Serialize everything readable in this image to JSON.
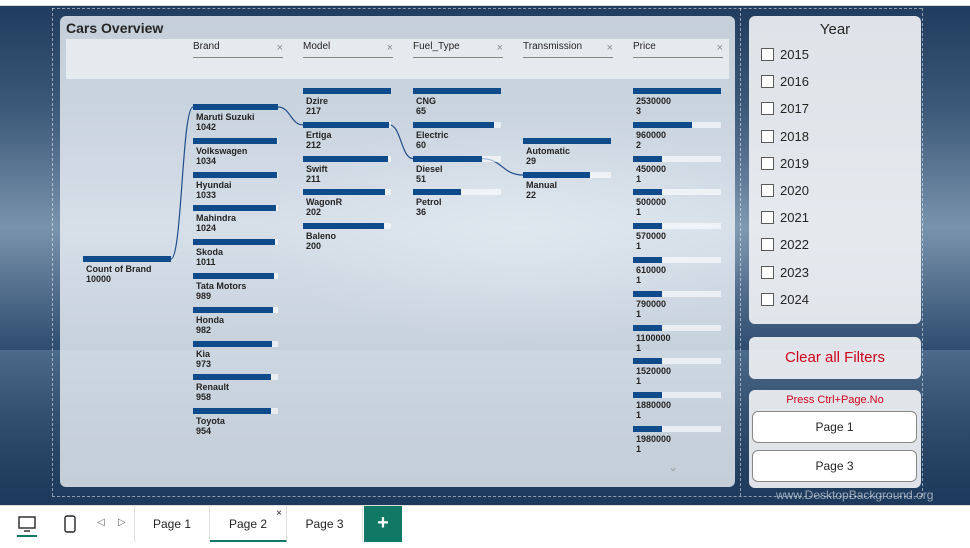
{
  "decomposition": {
    "title": "Cars Overview",
    "columns": [
      {
        "label": "Brand",
        "close": "×"
      },
      {
        "label": "Model",
        "close": "×"
      },
      {
        "label": "Fuel_Type",
        "close": "×"
      },
      {
        "label": "Transmission",
        "close": "×"
      },
      {
        "label": "Price",
        "close": "×"
      }
    ],
    "root": {
      "label": "Count of Brand",
      "value": "10000",
      "fraction": 1.0
    },
    "brand": [
      {
        "label": "Maruti Suzuki",
        "value": "1042",
        "fraction": 1.0
      },
      {
        "label": "Volkswagen",
        "value": "1034",
        "fraction": 0.99
      },
      {
        "label": "Hyundai",
        "value": "1033",
        "fraction": 0.99
      },
      {
        "label": "Mahindra",
        "value": "1024",
        "fraction": 0.98
      },
      {
        "label": "Skoda",
        "value": "1011",
        "fraction": 0.97
      },
      {
        "label": "Tata Motors",
        "value": "989",
        "fraction": 0.95
      },
      {
        "label": "Honda",
        "value": "982",
        "fraction": 0.94
      },
      {
        "label": "Kia",
        "value": "973",
        "fraction": 0.93
      },
      {
        "label": "Renault",
        "value": "958",
        "fraction": 0.92
      },
      {
        "label": "Toyota",
        "value": "954",
        "fraction": 0.92
      }
    ],
    "model": [
      {
        "label": "Dzire",
        "value": "217",
        "fraction": 1.0
      },
      {
        "label": "Ertiga",
        "value": "212",
        "fraction": 0.98
      },
      {
        "label": "Swift",
        "value": "211",
        "fraction": 0.97
      },
      {
        "label": "WagonR",
        "value": "202",
        "fraction": 0.93
      },
      {
        "label": "Baleno",
        "value": "200",
        "fraction": 0.92
      }
    ],
    "fuel": [
      {
        "label": "CNG",
        "value": "65",
        "fraction": 1.0
      },
      {
        "label": "Electric",
        "value": "60",
        "fraction": 0.92
      },
      {
        "label": "Diesel",
        "value": "51",
        "fraction": 0.78
      },
      {
        "label": "Petrol",
        "value": "36",
        "fraction": 0.55
      }
    ],
    "transmission": [
      {
        "label": "Automatic",
        "value": "29",
        "fraction": 1.0
      },
      {
        "label": "Manual",
        "value": "22",
        "fraction": 0.76
      }
    ],
    "price": [
      {
        "label": "2530000",
        "value": "3",
        "fraction": 1.0
      },
      {
        "label": "960000",
        "value": "2",
        "fraction": 0.67
      },
      {
        "label": "450000",
        "value": "1",
        "fraction": 0.33
      },
      {
        "label": "500000",
        "value": "1",
        "fraction": 0.33
      },
      {
        "label": "570000",
        "value": "1",
        "fraction": 0.33
      },
      {
        "label": "610000",
        "value": "1",
        "fraction": 0.33
      },
      {
        "label": "790000",
        "value": "1",
        "fraction": 0.33
      },
      {
        "label": "1100000",
        "value": "1",
        "fraction": 0.33
      },
      {
        "label": "1520000",
        "value": "1",
        "fraction": 0.33
      },
      {
        "label": "1880000",
        "value": "1",
        "fraction": 0.33
      },
      {
        "label": "1980000",
        "value": "1",
        "fraction": 0.33
      }
    ],
    "selected_path": [
      "Maruti Suzuki",
      "Ertiga",
      "Diesel",
      "Manual"
    ]
  },
  "year_slicer": {
    "title": "Year",
    "years": [
      "2015",
      "2016",
      "2017",
      "2018",
      "2019",
      "2020",
      "2021",
      "2022",
      "2023",
      "2024"
    ]
  },
  "clear_filters_label": "Clear all Filters",
  "nav": {
    "hint": "Press Ctrl+Page.No",
    "buttons": [
      "Page 1",
      "Page 3"
    ]
  },
  "watermark": "www.DesktopBackground.org",
  "tabs": {
    "pages": [
      "Page 1",
      "Page 2",
      "Page 3"
    ],
    "active": "Page 2",
    "close": "×",
    "add": "+"
  },
  "colors": {
    "bar": "#0f4a8a",
    "accent": "#117865",
    "filter_red": "#d0021b"
  }
}
